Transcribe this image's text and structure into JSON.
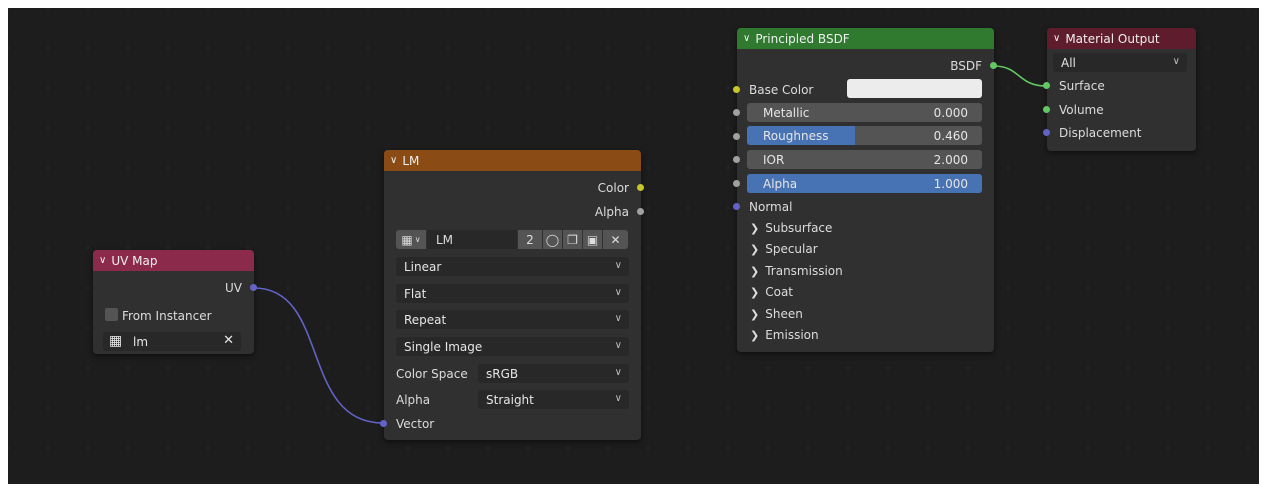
{
  "uv_map": {
    "title": "UV Map",
    "output": "UV",
    "from_instancer_label": "From Instancer",
    "from_instancer_checked": false,
    "map_value": "lm",
    "header_color": "#8b2a4a"
  },
  "image_texture": {
    "title": "LM",
    "outputs": [
      "Color",
      "Alpha"
    ],
    "image_name": "LM",
    "users_count": "2",
    "interpolation": "Linear",
    "projection": "Flat",
    "extension": "Repeat",
    "source": "Single Image",
    "color_space_label": "Color Space",
    "color_space": "sRGB",
    "alpha_label": "Alpha",
    "alpha_mode": "Straight",
    "input": "Vector",
    "header_color": "#8a4c14"
  },
  "principled": {
    "title": "Principled BSDF",
    "output": "BSDF",
    "base_color_label": "Base Color",
    "base_color_value": "#ececec",
    "inputs": [
      {
        "name": "Metallic",
        "value": "0.000",
        "fraction": 0.0
      },
      {
        "name": "Roughness",
        "value": "0.460",
        "fraction": 0.46
      },
      {
        "name": "IOR",
        "value": "2.000",
        "fraction": 0.0
      },
      {
        "name": "Alpha",
        "value": "1.000",
        "fraction": 1.0
      }
    ],
    "normal_label": "Normal",
    "panels": [
      "Subsurface",
      "Specular",
      "Transmission",
      "Coat",
      "Sheen",
      "Emission"
    ],
    "header_color": "#2f7a2f"
  },
  "material_output": {
    "title": "Material Output",
    "target": "All",
    "inputs": [
      "Surface",
      "Volume",
      "Displacement"
    ],
    "header_color": "#5e1c2c"
  },
  "colors": {
    "canvas": "#1d1d1d",
    "node_body": "#303030",
    "slider_fill": "#4772b3",
    "link_vector": "#6363c7",
    "link_shader": "#63c763"
  }
}
